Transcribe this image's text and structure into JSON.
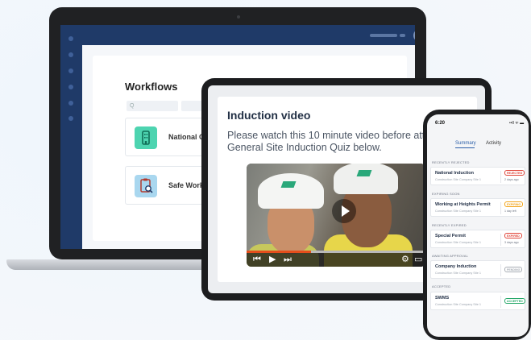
{
  "laptop": {
    "title": "Workflows",
    "search_placeholder": "Q",
    "items": [
      {
        "label": "National C",
        "icon": "building-icon",
        "color": "#4dd4b0"
      },
      {
        "label": "Safe Work",
        "icon": "clipboard-search-icon",
        "color": "#a9d7ef"
      }
    ]
  },
  "tablet": {
    "title": "Induction video",
    "text": "Please watch this 10 minute video before attempting the General Site Induction Quiz below.",
    "video": {
      "progress": 0.36,
      "controls": [
        "⏮",
        "▶",
        "⏭",
        "⚙",
        "▭"
      ]
    }
  },
  "phone": {
    "time": "6:20",
    "status": "••ll ᯤ ▬",
    "tabs": [
      {
        "label": "Summary",
        "active": true
      },
      {
        "label": "Activity",
        "active": false
      }
    ],
    "sections": [
      {
        "heading": "RECENTLY REJECTED",
        "item": {
          "title": "National Induction",
          "subtitle": "Construction Site Company Site 1",
          "badge": "REJECTED",
          "ago": "2 days ago",
          "badge_color": "#e0453a"
        }
      },
      {
        "heading": "EXPIRING SOON",
        "item": {
          "title": "Working at Heights Permit",
          "subtitle": "Construction Site Company Site 1",
          "badge": "EXPIRING",
          "ago": "1 day left",
          "badge_color": "#f2a51c"
        }
      },
      {
        "heading": "RECENTLY EXPIRED",
        "item": {
          "title": "Special Permit",
          "subtitle": "Construction Site Company Site 1",
          "badge": "EXPIRED",
          "ago": "3 days ago",
          "badge_color": "#e0453a"
        }
      },
      {
        "heading": "AWAITING APPROVAL",
        "item": {
          "title": "Company Induction",
          "subtitle": "Construction Site Company Site 1",
          "badge": "PENDING",
          "ago": "",
          "badge_color": "#a8adb5"
        }
      },
      {
        "heading": "ACCEPTED",
        "item": {
          "title": "SWMS",
          "subtitle": "Construction Site Company Site 1",
          "badge": "ACCEPTED",
          "ago": "",
          "badge_color": "#26a86a"
        }
      }
    ]
  }
}
